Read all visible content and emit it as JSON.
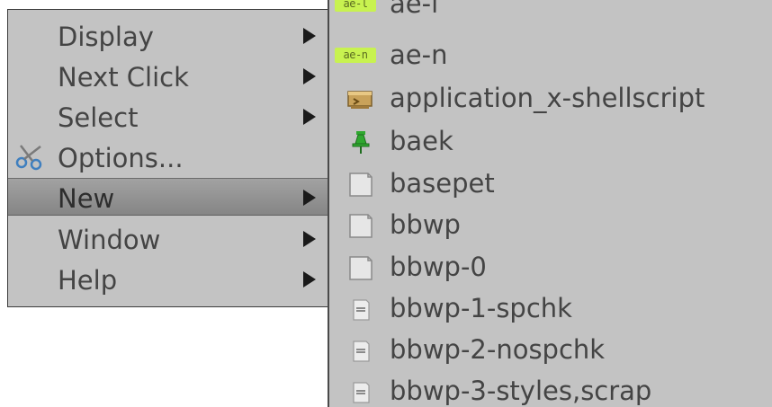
{
  "main_menu": {
    "items": [
      {
        "label": "Display",
        "has_submenu": true
      },
      {
        "label": "Next Click",
        "has_submenu": true
      },
      {
        "label": "Select",
        "has_submenu": true
      },
      {
        "label": "Options...",
        "has_submenu": false,
        "icon": "scissors-icon"
      },
      {
        "label": "New",
        "has_submenu": true,
        "highlighted": true
      },
      {
        "label": "Window",
        "has_submenu": true
      },
      {
        "label": "Help",
        "has_submenu": true
      }
    ]
  },
  "submenu": {
    "items": [
      {
        "label": "ae-l",
        "icon": "ae-tag-icon",
        "icon_text": "ae-l"
      },
      {
        "label": "ae-n",
        "icon": "ae-tag-icon",
        "icon_text": "ae-n"
      },
      {
        "label": "application_x-shellscript",
        "icon": "shellscript-icon"
      },
      {
        "label": "baek",
        "icon": "green-pushpin-icon"
      },
      {
        "label": "basepet",
        "icon": "blank-document-icon"
      },
      {
        "label": "bbwp",
        "icon": "blank-document-icon"
      },
      {
        "label": "bbwp-0",
        "icon": "blank-document-icon"
      },
      {
        "label": "bbwp-1-spchk",
        "icon": "text-document-icon"
      },
      {
        "label": "bbwp-2-nospchk",
        "icon": "text-document-icon"
      },
      {
        "label": "bbwp-3-styles,scrap",
        "icon": "text-document-icon"
      }
    ]
  },
  "colors": {
    "menu_background": "#c3c3c3",
    "highlight": "#959595",
    "border": "#3c3c3c",
    "tag_green": "#c8f250",
    "pushpin_green": "#2fa82f"
  }
}
